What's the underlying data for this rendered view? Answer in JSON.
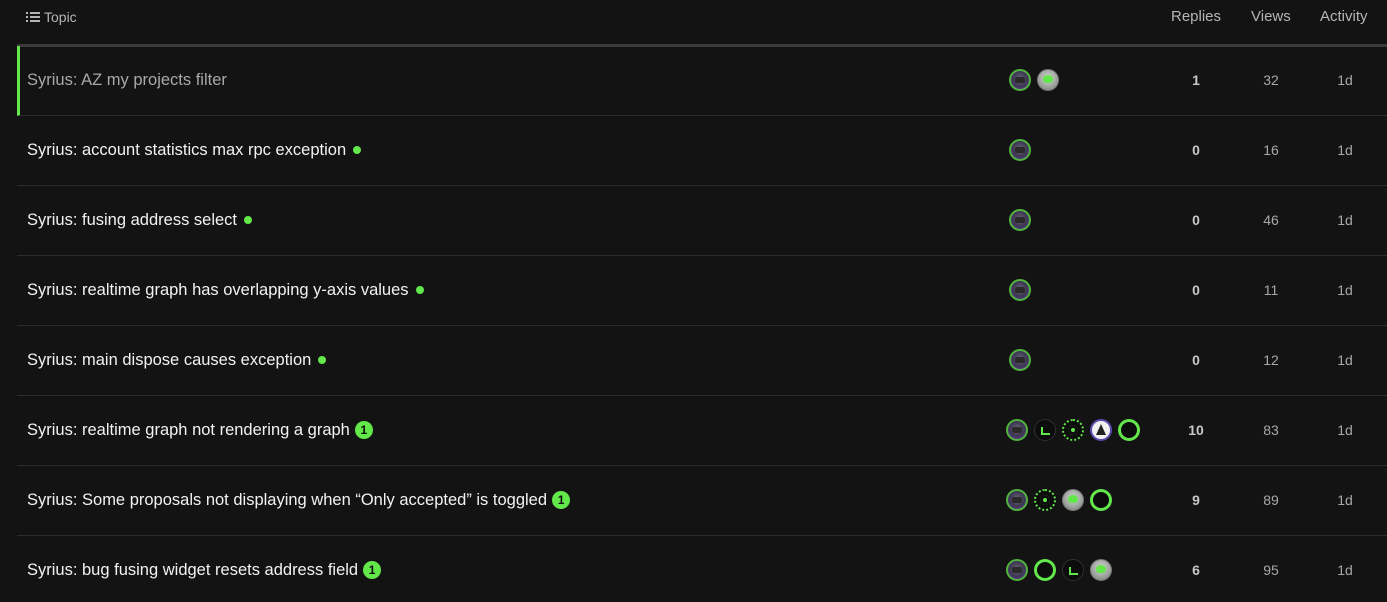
{
  "header": {
    "topic": "Topic",
    "replies": "Replies",
    "views": "Views",
    "activity": "Activity"
  },
  "topics": [
    {
      "title": "Syrius: AZ my projects filter",
      "replies": "1",
      "views": "32",
      "activity": "1d"
    },
    {
      "title": "Syrius: account statistics max rpc exception",
      "replies": "0",
      "views": "16",
      "activity": "1d"
    },
    {
      "title": "Syrius: fusing address select",
      "replies": "0",
      "views": "46",
      "activity": "1d"
    },
    {
      "title": "Syrius: realtime graph has overlapping y-axis values",
      "replies": "0",
      "views": "11",
      "activity": "1d"
    },
    {
      "title": "Syrius: main dispose causes exception",
      "replies": "0",
      "views": "12",
      "activity": "1d"
    },
    {
      "title": "Syrius: realtime graph not rendering a graph",
      "unread": "1",
      "replies": "10",
      "views": "83",
      "activity": "1d"
    },
    {
      "title": "Syrius: Some proposals not displaying when “Only accepted” is toggled",
      "unread": "1",
      "replies": "9",
      "views": "89",
      "activity": "1d"
    },
    {
      "title": "Syrius: bug fusing widget resets address field",
      "unread": "1",
      "replies": "6",
      "views": "95",
      "activity": "1d"
    }
  ],
  "colors": {
    "accent": "#63e84b",
    "background": "#131313",
    "text": "#f2f2f2"
  }
}
